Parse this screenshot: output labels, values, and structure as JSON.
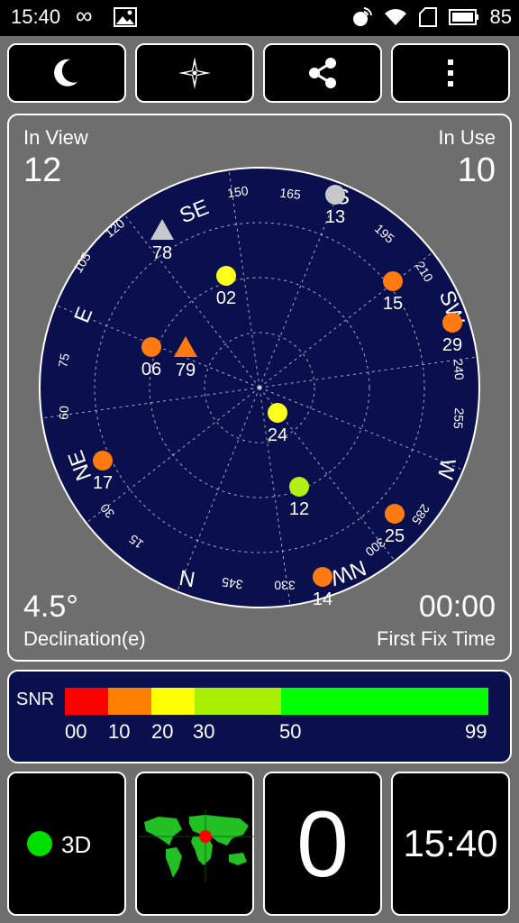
{
  "status_bar": {
    "time": "15:40",
    "infinity": "∞",
    "battery_level": "85"
  },
  "toolbar": {
    "buttons": [
      {
        "icon": "moon-icon"
      },
      {
        "icon": "compass-rose-icon"
      },
      {
        "icon": "share-icon"
      },
      {
        "icon": "more-vertical-icon"
      }
    ]
  },
  "radar": {
    "in_view_label": "In View",
    "in_view_value": "12",
    "in_use_label": "In Use",
    "in_use_value": "10",
    "declination_value": "4.5°",
    "declination_label": "Declination(e)",
    "first_fix_value": "00:00",
    "first_fix_label": "First Fix Time",
    "colors": {
      "disc": "#0a0f4e",
      "orange": "#ff7a10",
      "yellow": "#ffff1e",
      "lime": "#b2f014",
      "grey": "#c8c8c8"
    },
    "direction_labels": [
      "SE",
      "S",
      "SW",
      "W",
      "NW",
      "N",
      "NE",
      "E"
    ],
    "degree_labels": [
      "150",
      "165",
      "195",
      "210",
      "240",
      "255",
      "285",
      "300",
      "330",
      "345",
      "15",
      "30",
      "60",
      "75",
      "105",
      "120"
    ],
    "satellites": [
      {
        "id": "13",
        "shape": "circle",
        "color": "grey"
      },
      {
        "id": "78",
        "shape": "triangle",
        "color": "grey"
      },
      {
        "id": "02",
        "shape": "circle",
        "color": "yellow"
      },
      {
        "id": "15",
        "shape": "circle",
        "color": "orange"
      },
      {
        "id": "29",
        "shape": "circle",
        "color": "orange"
      },
      {
        "id": "06",
        "shape": "circle",
        "color": "orange"
      },
      {
        "id": "79",
        "shape": "triangle",
        "color": "orange"
      },
      {
        "id": "24",
        "shape": "circle",
        "color": "yellow"
      },
      {
        "id": "17",
        "shape": "circle",
        "color": "orange"
      },
      {
        "id": "12",
        "shape": "circle",
        "color": "lime"
      },
      {
        "id": "25",
        "shape": "circle",
        "color": "orange"
      },
      {
        "id": "14",
        "shape": "circle",
        "color": "orange"
      }
    ]
  },
  "snr": {
    "label": "SNR",
    "segments": [
      {
        "color": "#ff0000"
      },
      {
        "color": "#ff8000"
      },
      {
        "color": "#ffff00"
      },
      {
        "color": "#a8f000"
      },
      {
        "color": "#00ff00"
      }
    ],
    "ticks": [
      "00",
      "10",
      "20",
      "30",
      "50",
      "99"
    ]
  },
  "bottom": {
    "fix_mode": "3D",
    "fix_color": "#00e000",
    "map_icon": "world-map-icon",
    "big_value": "0",
    "clock": "15:40"
  }
}
